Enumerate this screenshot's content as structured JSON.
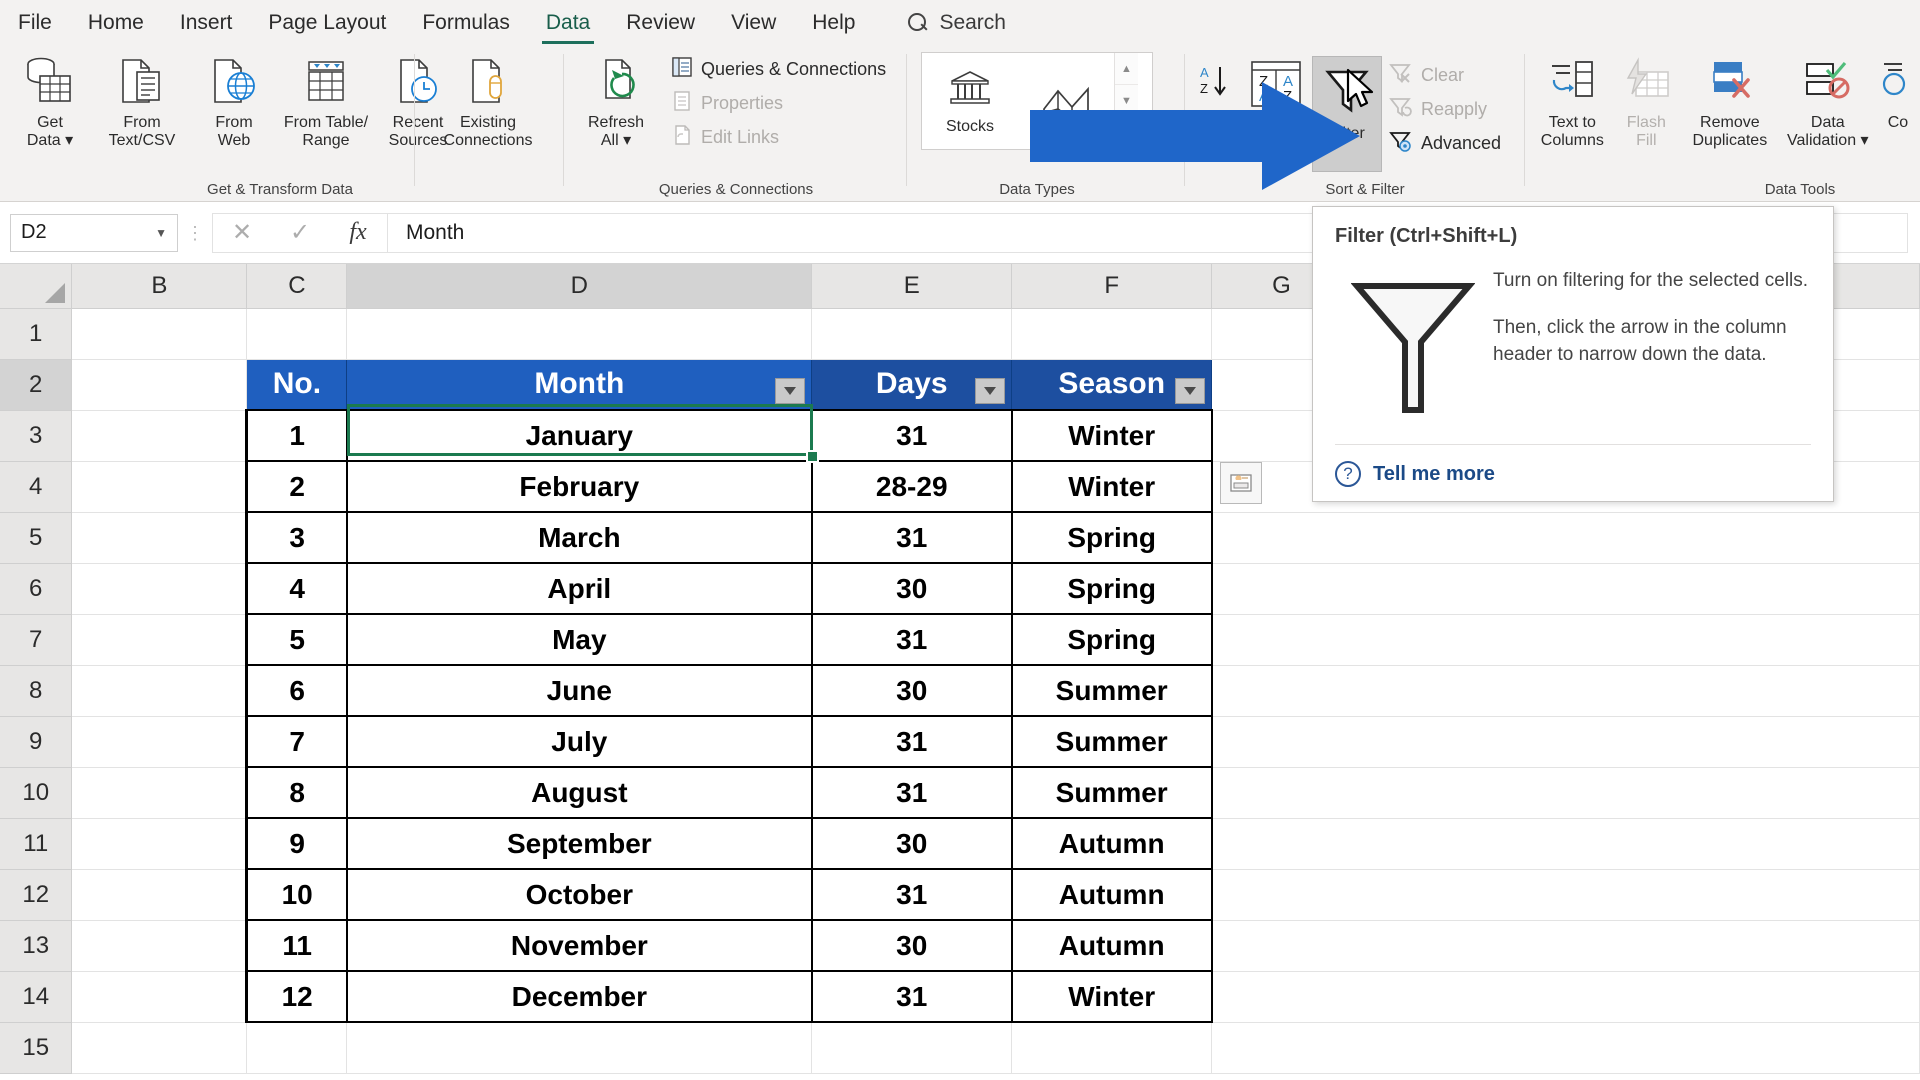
{
  "tabs": [
    {
      "label": "File",
      "active": false
    },
    {
      "label": "Home",
      "active": false
    },
    {
      "label": "Insert",
      "active": false
    },
    {
      "label": "Page Layout",
      "active": false
    },
    {
      "label": "Formulas",
      "active": false
    },
    {
      "label": "Data",
      "active": true
    },
    {
      "label": "Review",
      "active": false
    },
    {
      "label": "View",
      "active": false
    },
    {
      "label": "Help",
      "active": false
    }
  ],
  "search": {
    "label": "Search"
  },
  "ribbon": {
    "groups": [
      {
        "label": "Get & Transform Data",
        "buttons": [
          {
            "label": "Get\nData ▾",
            "icon": "get-data-icon",
            "disabled": false
          },
          {
            "label": "From\nText/CSV",
            "icon": "from-text-csv-icon",
            "disabled": false
          },
          {
            "label": "From\nWeb",
            "icon": "from-web-icon",
            "disabled": false
          },
          {
            "label": "From Table/\nRange",
            "icon": "from-table-range-icon",
            "disabled": false
          },
          {
            "label": "Recent\nSources",
            "icon": "recent-sources-icon",
            "disabled": false
          },
          {
            "label": "Existing\nConnections",
            "icon": "existing-connections-icon",
            "disabled": false
          }
        ]
      },
      {
        "label": "Queries & Connections",
        "refresh": {
          "label": "Refresh\nAll ▾",
          "icon": "refresh-all-icon"
        },
        "small": [
          {
            "label": "Queries & Connections",
            "icon": "queries-connections-icon",
            "disabled": false
          },
          {
            "label": "Properties",
            "icon": "properties-icon",
            "disabled": true
          },
          {
            "label": "Edit Links",
            "icon": "edit-links-icon",
            "disabled": true
          }
        ]
      },
      {
        "label": "Data Types",
        "items": [
          {
            "label": "Stocks",
            "icon": "stocks-icon"
          },
          {
            "label": "Geography",
            "icon": "geography-icon"
          }
        ]
      },
      {
        "label": "Sort & Filter",
        "sort_az": "sort-ascending-icon",
        "sort_za": "sort-descending-icon",
        "sort_custom": "custom-sort-icon",
        "filter": {
          "label": "Filter",
          "icon": "filter-funnel-icon",
          "active": true
        },
        "small": [
          {
            "label": "Clear",
            "icon": "clear-filter-icon",
            "disabled": true
          },
          {
            "label": "Reapply",
            "icon": "reapply-filter-icon",
            "disabled": true
          },
          {
            "label": "Advanced",
            "icon": "advanced-filter-icon",
            "disabled": false
          }
        ]
      },
      {
        "label": "Data Tools",
        "buttons": [
          {
            "label": "Text to\nColumns",
            "icon": "text-to-columns-icon",
            "disabled": false
          },
          {
            "label": "Flash\nFill",
            "icon": "flash-fill-icon",
            "disabled": true
          },
          {
            "label": "Remove\nDuplicates",
            "icon": "remove-duplicates-icon",
            "disabled": false
          },
          {
            "label": "Data\nValidation ▾",
            "icon": "data-validation-icon",
            "disabled": false
          },
          {
            "label": "Co",
            "icon": "consolidate-icon",
            "disabled": false
          }
        ]
      }
    ]
  },
  "formula_bar": {
    "name_box": "D2",
    "cancel": "✕",
    "enter": "✓",
    "fx": "fx",
    "content": "Month"
  },
  "sheet": {
    "columns": [
      "B",
      "C",
      "D",
      "E",
      "F",
      "G"
    ],
    "selected_column": "D",
    "rows": [
      "1",
      "2",
      "3",
      "4",
      "5",
      "6",
      "7",
      "8",
      "9",
      "10",
      "11",
      "12",
      "13",
      "14",
      "15"
    ],
    "selected_row": "2",
    "table_headers": [
      "No.",
      "Month",
      "Days",
      "Season"
    ],
    "table_rows": [
      [
        "1",
        "January",
        "31",
        "Winter"
      ],
      [
        "2",
        "February",
        "28-29",
        "Winter"
      ],
      [
        "3",
        "March",
        "31",
        "Spring"
      ],
      [
        "4",
        "April",
        "30",
        "Spring"
      ],
      [
        "5",
        "May",
        "31",
        "Spring"
      ],
      [
        "6",
        "June",
        "30",
        "Summer"
      ],
      [
        "7",
        "July",
        "31",
        "Summer"
      ],
      [
        "8",
        "August",
        "31",
        "Summer"
      ],
      [
        "9",
        "September",
        "30",
        "Autumn"
      ],
      [
        "10",
        "October",
        "31",
        "Autumn"
      ],
      [
        "11",
        "November",
        "30",
        "Autumn"
      ],
      [
        "12",
        "December",
        "31",
        "Winter"
      ]
    ]
  },
  "tooltip": {
    "title": "Filter (Ctrl+Shift+L)",
    "paragraph1": "Turn on filtering for the selected cells.",
    "paragraph2": "Then, click the arrow in the column header to narrow down the data.",
    "link": "Tell me more",
    "help_glyph": "?"
  },
  "colors": {
    "ribbon_bg": "#f3f2f1",
    "accent_tab": "#1d6f5c",
    "table_header_blue": "#1f5fbf",
    "table_header_dark": "#1d4fa0",
    "arrow_blue": "#1f66c9",
    "selection_green": "#1b7a4f"
  }
}
